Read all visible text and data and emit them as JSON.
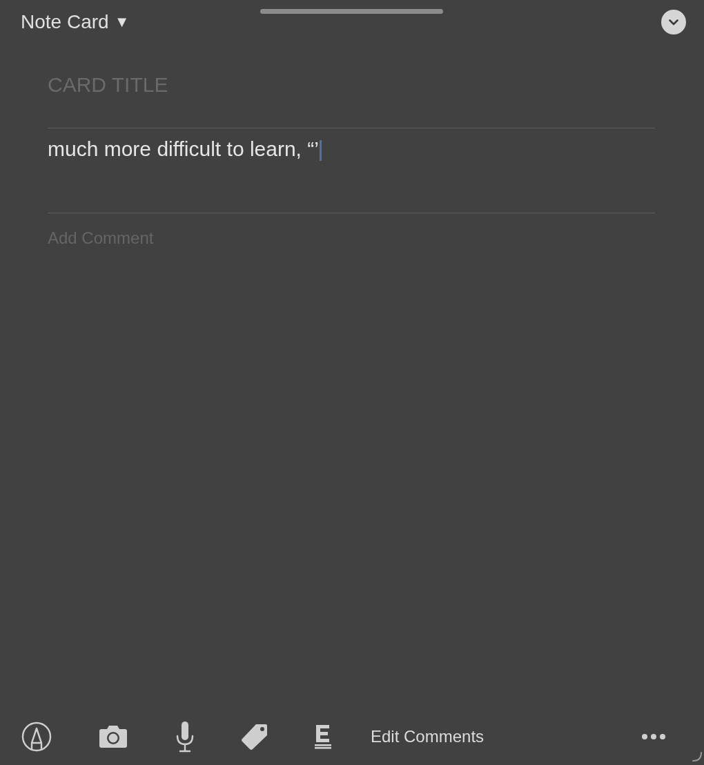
{
  "header": {
    "title": "Note Card",
    "dropdown_glyph": "▼"
  },
  "card": {
    "title_field": {
      "placeholder": "CARD TITLE"
    },
    "body_field": {
      "value": "much more difficult to learn, “’",
      "focused": true
    },
    "comment_field": {
      "placeholder": "Add Comment"
    }
  },
  "toolbar": [
    {
      "kind": "markup"
    },
    {
      "kind": "camera"
    },
    {
      "kind": "microphone"
    },
    {
      "kind": "tag"
    },
    {
      "kind": "text-format"
    },
    {
      "kind": "text",
      "label": "Edit Comments"
    },
    {
      "kind": "more"
    }
  ]
}
